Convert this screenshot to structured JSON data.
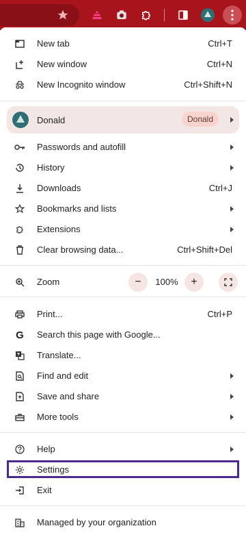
{
  "toolbar": {
    "icons": [
      "star-icon",
      "extension-pink-icon",
      "camera-icon",
      "puzzle-icon",
      "side-panel-icon",
      "profile-avatar-icon",
      "more-menu-icon"
    ]
  },
  "menu": {
    "new_tab": {
      "label": "New tab",
      "shortcut": "Ctrl+T"
    },
    "new_window": {
      "label": "New window",
      "shortcut": "Ctrl+N"
    },
    "new_incognito": {
      "label": "New Incognito window",
      "shortcut": "Ctrl+Shift+N"
    },
    "profile": {
      "name": "Donald",
      "badge": "Donald"
    },
    "passwords": {
      "label": "Passwords and autofill"
    },
    "history": {
      "label": "History"
    },
    "downloads": {
      "label": "Downloads",
      "shortcut": "Ctrl+J"
    },
    "bookmarks": {
      "label": "Bookmarks and lists"
    },
    "extensions": {
      "label": "Extensions"
    },
    "clear_data": {
      "label": "Clear browsing data...",
      "shortcut": "Ctrl+Shift+Del"
    },
    "zoom": {
      "label": "Zoom",
      "minus": "−",
      "value": "100%",
      "plus": "+"
    },
    "print": {
      "label": "Print...",
      "shortcut": "Ctrl+P"
    },
    "search_google": {
      "label": "Search this page with Google..."
    },
    "translate": {
      "label": "Translate..."
    },
    "find_edit": {
      "label": "Find and edit"
    },
    "save_share": {
      "label": "Save and share"
    },
    "more_tools": {
      "label": "More tools"
    },
    "help": {
      "label": "Help"
    },
    "settings": {
      "label": "Settings"
    },
    "exit": {
      "label": "Exit"
    },
    "managed": {
      "label": "Managed by your organization"
    }
  },
  "colors": {
    "toolbar": "#a8141c",
    "highlight": "#4b2a8e",
    "profile_bg": "#f3e7e6"
  }
}
